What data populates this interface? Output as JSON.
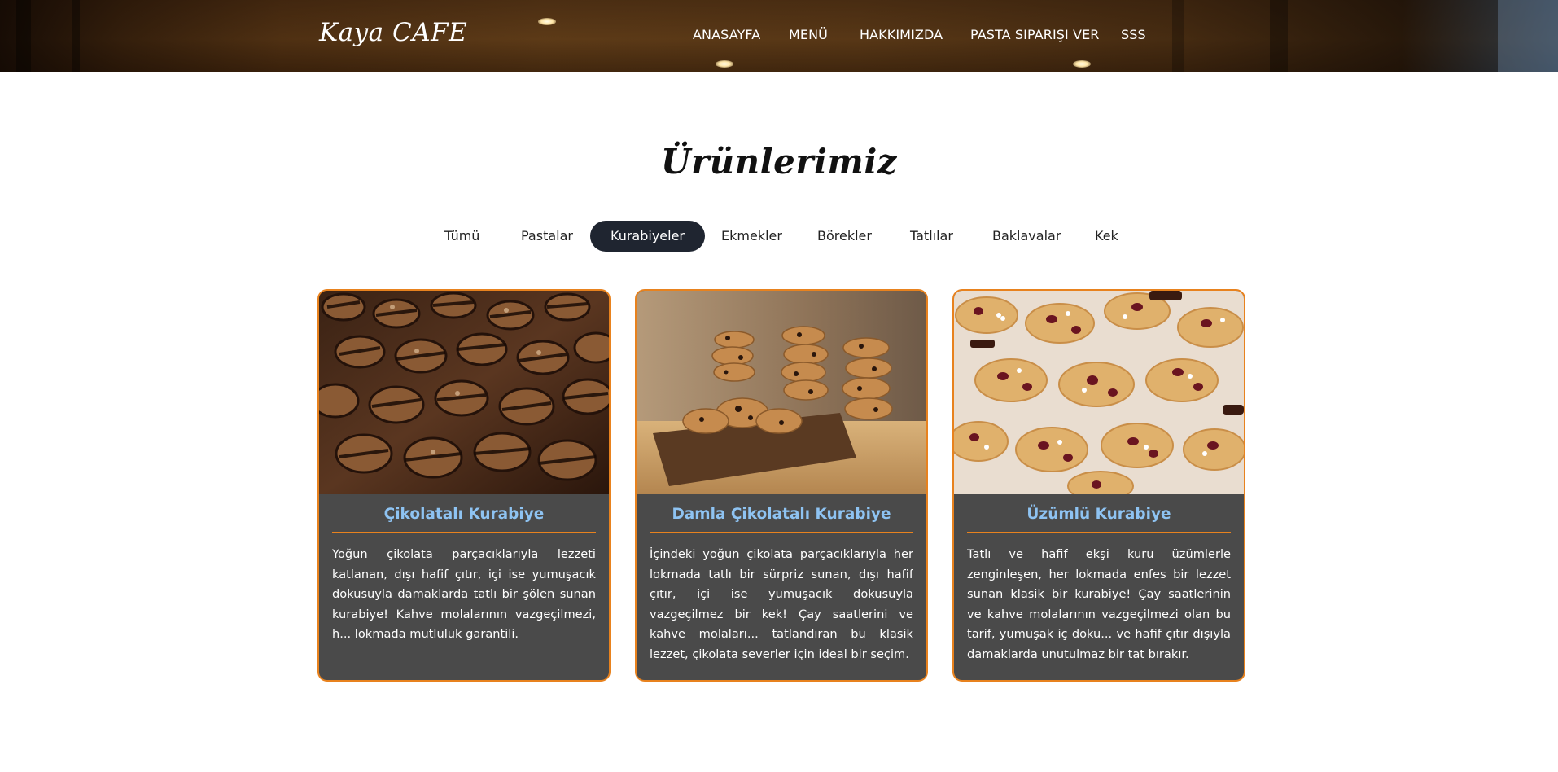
{
  "header": {
    "brand": "Kaya CAFE",
    "nav": [
      {
        "label": "ANASAYFA"
      },
      {
        "label": "MENÜ"
      },
      {
        "label": "HAKKIMIZDA"
      },
      {
        "label": "PASTA SIPARIŞI VER"
      },
      {
        "label": "SSS"
      }
    ]
  },
  "products": {
    "title": "Ürünlerimiz",
    "filters": [
      {
        "label": "Tümü",
        "active": false
      },
      {
        "label": "Pastalar",
        "active": false
      },
      {
        "label": "Kurabiyeler",
        "active": true
      },
      {
        "label": "Ekmekler",
        "active": false
      },
      {
        "label": "Börekler",
        "active": false
      },
      {
        "label": "Tatlılar",
        "active": false
      },
      {
        "label": "Baklavalar",
        "active": false
      },
      {
        "label": "Kek",
        "active": false
      }
    ],
    "cards": [
      {
        "title": "Çikolatalı Kurabiye",
        "description": "Yoğun çikolata parçacıklarıyla lezzeti katlanan, dışı hafif çıtır, içi ise yumuşacık dokusuyla damaklarda tatlı bir şölen sunan kurabiye! Kahve molalarının vazgeçilmezi, h... lokmada mutluluk garantili."
      },
      {
        "title": "Damla Çikolatalı Kurabiye",
        "description": "İçindeki yoğun çikolata parçacıklarıyla her lokmada tatlı bir sürpriz sunan, dışı hafif çıtır, içi ise yumuşacık dokusuyla vazgeçilmez bir kek! Çay saatlerini ve kahve molaları... tatlandıran bu klasik lezzet, çikolata severler için ideal bir seçim."
      },
      {
        "title": "Üzümlü Kurabiye",
        "description": "Tatlı ve hafif ekşi kuru üzümlerle zenginleşen, her lokmada enfes bir lezzet sunan klasik bir kurabiye! Çay saatlerinin ve kahve molalarının vazgeçilmezi olan bu tarif, yumuşak iç doku... ve hafif çıtır dışıyla damaklarda unutulmaz bir tat bırakır."
      }
    ]
  },
  "colors": {
    "accent": "#e8821e",
    "card_background": "#4a4a4a",
    "card_title": "#8ec3f2",
    "active_tab": "#1f2530"
  }
}
